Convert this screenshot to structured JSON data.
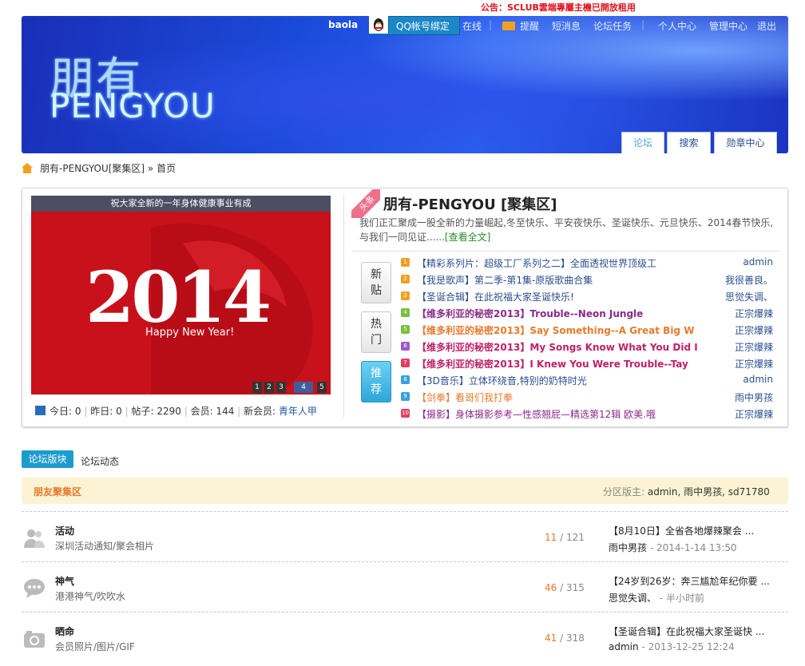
{
  "notice": "公告：SCLUB雲端專屬主機已開放租用",
  "banner": {
    "logo_cn": "朋有",
    "logo_en": "PENGYOU",
    "username": "baola",
    "qq_bind": "QQ帐号绑定",
    "online": "在线",
    "remind": "提醒",
    "pm": "短消息",
    "tasks": "论坛任务",
    "user_center": "个人中心",
    "admin_center": "管理中心",
    "logout": "退出",
    "tabs": [
      "论坛",
      "搜索",
      "勋章中心"
    ]
  },
  "breadcrumb": {
    "site": "朋有-PENGYOU[聚集区]",
    "sep": "»",
    "page": "首页"
  },
  "slider": {
    "caption": "祝大家全新的一年身体健康事业有成",
    "year": "2014",
    "greeting": "Happy New Year!",
    "pages": [
      "1",
      "2",
      "3",
      "4",
      "5"
    ],
    "active_page": "4"
  },
  "stats": {
    "today_label": "今日:",
    "today": "0",
    "yesterday_label": "昨日:",
    "yesterday": "0",
    "posts_label": "帖子:",
    "posts": "2290",
    "members_label": "会员:",
    "members": "144",
    "newest_label": "新会员:",
    "newest": "青年人甲"
  },
  "headline": {
    "ribbon": "头条",
    "title": "朋有-PENGYOU [聚集区]",
    "desc": "我们正汇聚成一股全新的力量崛起,冬至快乐、平安夜快乐、圣诞快乐、元旦快乐、2014春节快乐,与我们一同见证......",
    "more": "[查看全文]"
  },
  "side_buttons": [
    {
      "label1": "新",
      "label2": "贴"
    },
    {
      "label1": "热",
      "label2": "门"
    },
    {
      "label1": "推",
      "label2": "荐"
    }
  ],
  "topics": [
    {
      "num": "1",
      "title": "【精彩系列片：超级工厂系列之二】全面透视世界顶级工",
      "author": "admin",
      "color": "#2a4e8e",
      "badge": "#f2a020"
    },
    {
      "num": "2",
      "title": "【我是歌声】第二季-第1集-原版歌曲合集",
      "author": "我很善良。",
      "color": "#2a4e8e",
      "badge": "#f2a020"
    },
    {
      "num": "3",
      "title": "【圣诞合辑】在此祝福大家圣诞快乐!",
      "author": "思觉失调、",
      "color": "#2a4e8e",
      "badge": "#f2a020"
    },
    {
      "num": "4",
      "title": "【维多利亚的秘密2013】Trouble--Neon Jungle",
      "author": "正宗爆辣",
      "color": "#8a2a8a",
      "badge": "#7cbf3a"
    },
    {
      "num": "5",
      "title": "【维多利亚的秘密2013】Say Something--A Great Big W",
      "author": "正宗爆辣",
      "color": "#e8792c",
      "badge": "#7cbf3a"
    },
    {
      "num": "6",
      "title": "【维多利亚的秘密2013】My Songs Know What You Did I",
      "author": "正宗爆辣",
      "color": "#c0206a",
      "badge": "#a05ac8"
    },
    {
      "num": "7",
      "title": "【维多利亚的秘密2013】I Knew You Were Trouble--Tay",
      "author": "正宗爆辣",
      "color": "#c0206a",
      "badge": "#e04060"
    },
    {
      "num": "8",
      "title": "【3D音乐】立体环绕音,特别的奶特时光",
      "author": "admin",
      "color": "#2a4e8e",
      "badge": "#3aa0d8"
    },
    {
      "num": "9",
      "title": "【剑拳】看哥们我打拳",
      "author": "雨中男孩",
      "color": "#e8792c",
      "badge": "#3aa0d8"
    },
    {
      "num": "10",
      "title": "【摄影】身体摄影参考—性感翘屁—精选第12辑 欧美.哦",
      "author": "正宗爆辣",
      "color": "#8a2a8a",
      "badge": "#e04060"
    }
  ],
  "forum_tabs": [
    "论坛版块",
    "论坛动态"
  ],
  "category": {
    "name": "朋友聚集区",
    "mods_label": "分区版主:",
    "mods": "admin, 雨中男孩, sd71780"
  },
  "forums": [
    {
      "name": "活动",
      "desc": "深圳活动通知/聚会相片",
      "threads": "11",
      "posts": "121",
      "last_title": "【8月10日】全省各地爆辣聚会 ...",
      "last_user": "雨中男孩",
      "last_time": " - 2014-1-14 13:50",
      "icon": "people-icon"
    },
    {
      "name": "神气",
      "desc": "港港神气/吹吹水",
      "threads": "46",
      "posts": "315",
      "last_title": "【24岁到26岁：奔三尴尬年纪你要 ...",
      "last_user": "思觉失调、",
      "last_time": " - 半小时前",
      "icon": "chat-icon"
    },
    {
      "name": "晒命",
      "desc": "会员照片/图片/GIF",
      "threads": "41",
      "posts": "318",
      "last_title": "【圣诞合辑】在此祝福大家圣诞快 ...",
      "last_user": "admin",
      "last_time": " - 2013-12-25 12:24",
      "icon": "camera-icon"
    }
  ]
}
